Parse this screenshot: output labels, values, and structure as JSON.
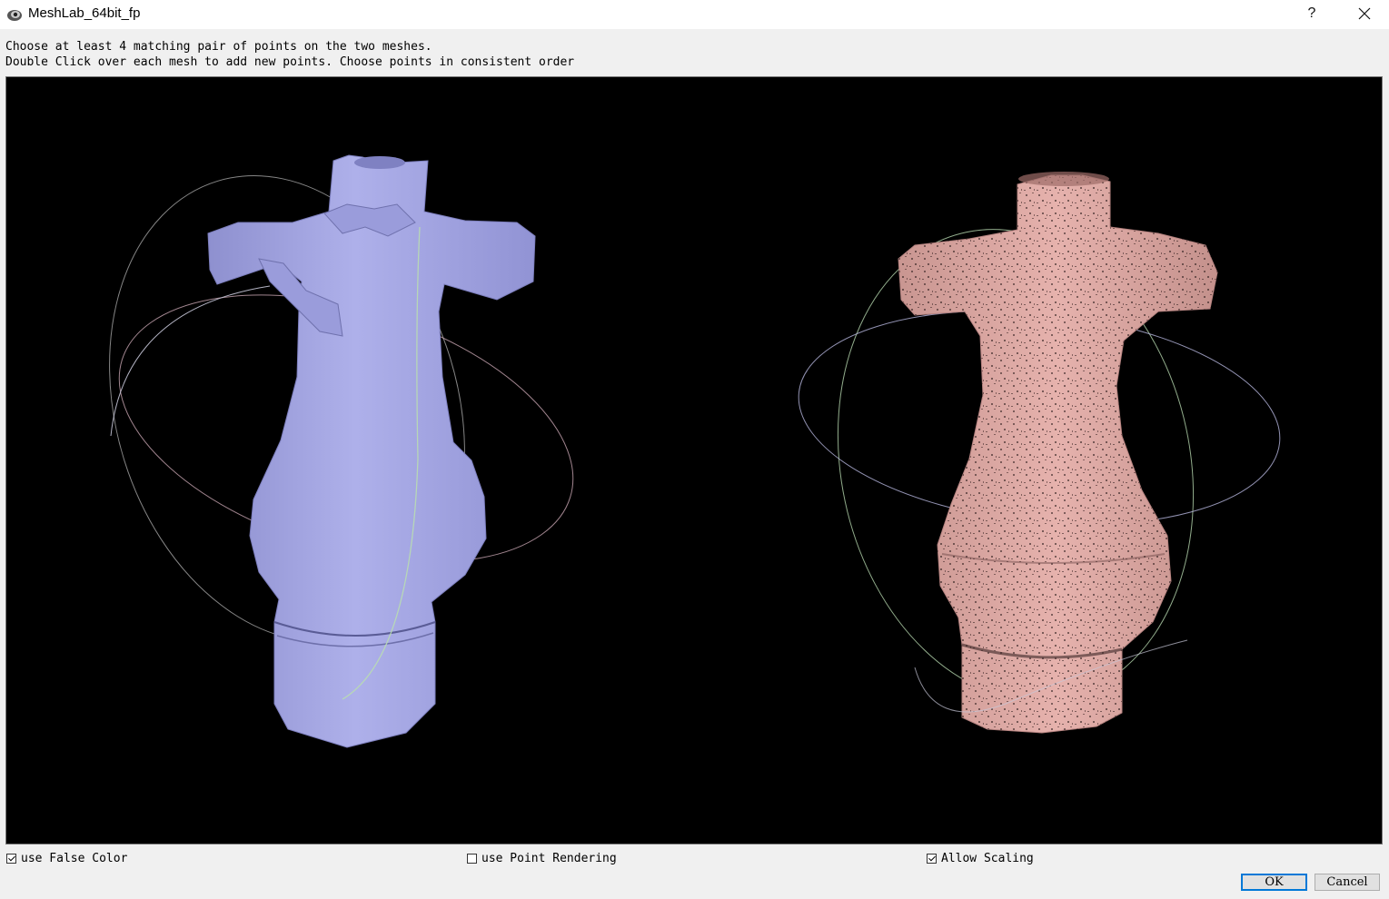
{
  "window": {
    "title": "MeshLab_64bit_fp",
    "help_label": "?"
  },
  "instructions": {
    "line1": "Choose at least 4 matching pair of points on the two meshes.",
    "line2": "Double Click over each mesh to add new points. Choose points in consistent order"
  },
  "viewport": {
    "background": "#000000",
    "left_mesh": {
      "icon": "purple-mesh",
      "color": "#a7a9e3"
    },
    "right_mesh": {
      "icon": "pink-point-cloud",
      "color": "#e2aba6"
    }
  },
  "options": {
    "false_color": {
      "label": "use False Color",
      "checked": true
    },
    "point_rendering": {
      "label": "use Point Rendering",
      "checked": false
    },
    "allow_scaling": {
      "label": "Allow Scaling",
      "checked": true
    }
  },
  "buttons": {
    "ok": "OK",
    "cancel": "Cancel"
  },
  "colors": {
    "accent": "#0078d7",
    "dialog_bg": "#f0f0f0"
  }
}
